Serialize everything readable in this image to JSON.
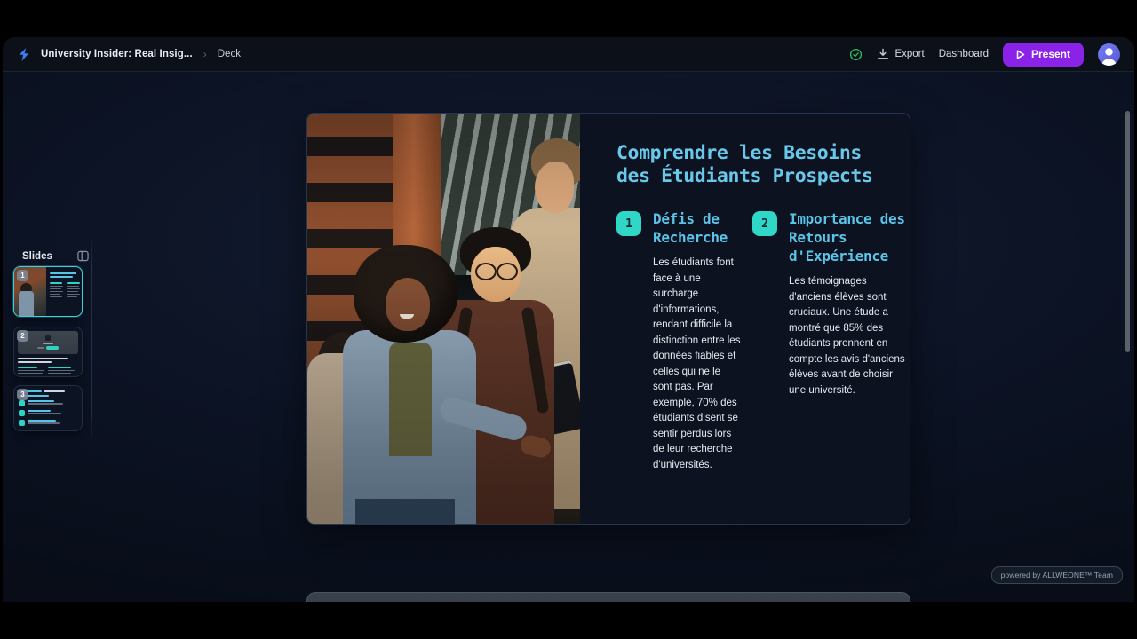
{
  "header": {
    "doc_title": "University Insider: Real Insig...",
    "breadcrumb_separator": "›",
    "breadcrumb_current": "Deck",
    "export_label": "Export",
    "dashboard_label": "Dashboard",
    "present_label": "Present"
  },
  "sidebar": {
    "title": "Slides",
    "slide_numbers": [
      "1",
      "2",
      "3"
    ]
  },
  "slide": {
    "title": "Comprendre les Besoins des Étudiants Prospects",
    "sections": [
      {
        "number": "1",
        "heading": "Défis de Recherche",
        "body": "Les étudiants font face à une surcharge d'informations, rendant difficile la distinction entre les données fiables et celles qui ne le sont pas. Par exemple, 70% des étudiants disent se sentir perdus lors de leur recherche d'universités."
      },
      {
        "number": "2",
        "heading": "Importance des Retours d'Expérience",
        "body": "Les témoignages d'anciens élèves sont cruciaux. Une étude a montré que 85% des étudiants prennent en compte les avis d'anciens élèves avant de choisir une université."
      }
    ]
  },
  "watermark": "powered by ALLWEONE™ Team",
  "icons": {
    "logo": "bolt-logo",
    "saved": "check-circle",
    "export": "download",
    "present": "play",
    "avatar": "user",
    "slides_panel": "panel-toggle"
  },
  "colors": {
    "accent_teal": "#30d6c6",
    "heading_cyan": "#5ac4e8",
    "title_cyan": "#69c8ea",
    "present_purple": "#8b22e8",
    "logo_blue": "#3f7bf6",
    "check_green": "#2fbf5f",
    "canvas_navy": "#0c1324",
    "slide_bg": "#0c1220"
  }
}
